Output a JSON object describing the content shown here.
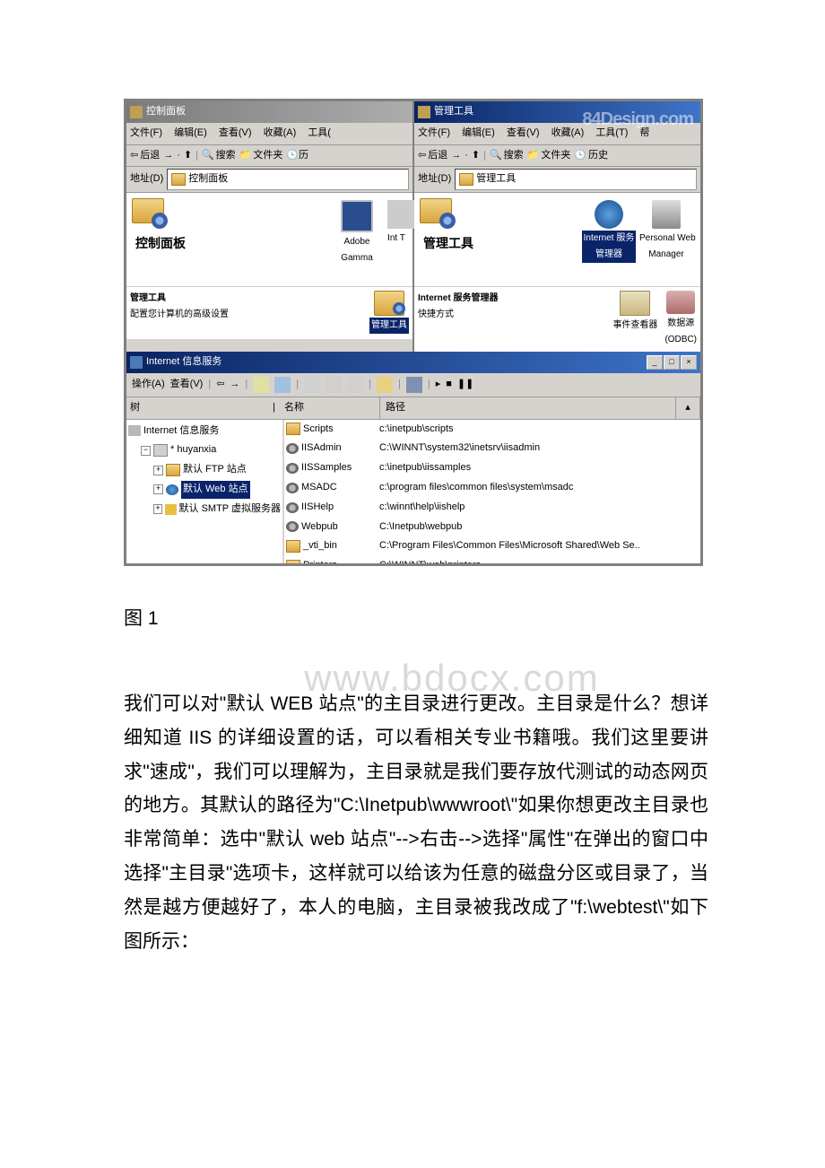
{
  "caption": "图 1",
  "watermark_site": "www.bdocx.com",
  "watermark_logo": "84Design.com",
  "body_text": "我们可以对\"默认 WEB 站点\"的主目录进行更改。主目录是什么？想详细知道 IIS 的详细设置的话，可以看相关专业书籍哦。我们这里要讲求\"速成\"，我们可以理解为，主目录就是我们要存放代测试的动态网页的地方。其默认的路径为\"C:\\Inetpub\\wwwroot\\\"如果你想更改主目录也非常简单：选中\"默认 web 站点\"-->右击-->选择\"属性\"在弹出的窗口中选择\"主目录\"选项卡，这样就可以给该为任意的磁盘分区或目录了，当然是越方便越好了，本人的电脑，主目录被我改成了\"f:\\webtest\\\"如下图所示：",
  "win_cp": {
    "title": "控制面板",
    "menus": [
      "文件(F)",
      "编辑(E)",
      "查看(V)",
      "收藏(A)",
      "工具("
    ],
    "back": "后退",
    "search": "搜索",
    "folders": "文件夹",
    "addr_label": "地址(D)",
    "addr_value": "控制面板",
    "heading": "控制面板",
    "item_adobe": "Adobe Gamma",
    "item_int": "Int\nT",
    "sub_title": "管理工具",
    "sub_desc": "配置您计算机的高级设置",
    "sub_icon_label": "管理工具"
  },
  "win_admin": {
    "title": "管理工具",
    "menus": [
      "文件(F)",
      "编辑(E)",
      "查看(V)",
      "收藏(A)",
      "工具(T)",
      "帮"
    ],
    "back": "后退",
    "search": "搜索",
    "folders": "文件夹",
    "history": "历史",
    "addr_label": "地址(D)",
    "addr_value": "管理工具",
    "heading": "管理工具",
    "item_ism": "Internet 服务\n管理器",
    "item_pwm": "Personal Web\nManager",
    "sub_title": "Internet 服务管理器",
    "sub_desc": "快捷方式",
    "icon_event": "事件查看器",
    "icon_odbc": "数据源\n(ODBC)"
  },
  "win_iis": {
    "title": "Internet 信息服务",
    "menu_action": "操作(A)",
    "menu_view": "查看(V)",
    "tree_header": "树",
    "col_name": "名称",
    "col_path": "路径",
    "tree": {
      "root": "Internet 信息服务",
      "server": "* huyanxia",
      "ftp": "默认 FTP 站点",
      "web": "默认 Web 站点",
      "smtp": "默认 SMTP 虚拟服务器"
    },
    "items": [
      {
        "name": "Scripts",
        "path": "c:\\inetpub\\scripts",
        "t": "f"
      },
      {
        "name": "IISAdmin",
        "path": "C:\\WINNT\\system32\\inetsrv\\iisadmin",
        "t": "g"
      },
      {
        "name": "IISSamples",
        "path": "c:\\inetpub\\iissamples",
        "t": "g"
      },
      {
        "name": "MSADC",
        "path": "c:\\program files\\common files\\system\\msadc",
        "t": "g"
      },
      {
        "name": "IISHelp",
        "path": "c:\\winnt\\help\\iishelp",
        "t": "g"
      },
      {
        "name": "Webpub",
        "path": "C:\\Inetpub\\webpub",
        "t": "g"
      },
      {
        "name": "_vti_bin",
        "path": "C:\\Program Files\\Common Files\\Microsoft Shared\\Web Se..",
        "t": "f"
      },
      {
        "name": "Printers",
        "path": "C:\\WINNT\\web\\printers",
        "t": "f"
      }
    ]
  }
}
